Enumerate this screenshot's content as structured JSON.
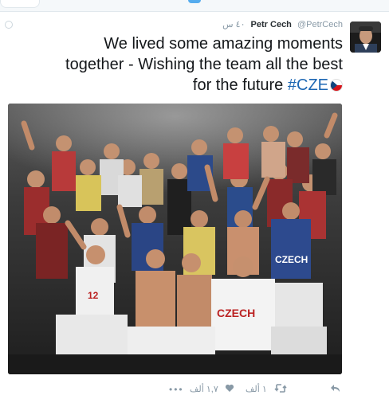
{
  "tweet": {
    "time": "٤٠ س",
    "handle": "@PetrCech",
    "name": "Petr Cech",
    "text_line1": "We lived some amazing moments",
    "text_line2": "together - Wishing the team all the best",
    "text_line3": "for the future",
    "hashtag": "#CZE",
    "photo_shirt_text1": "CZECH",
    "photo_shirt_text2": "CZECH",
    "photo_shirt_number": "12"
  },
  "actions": {
    "more": "•••",
    "likes": "١,٧ ألف",
    "retweets": "١ ألف"
  },
  "colors": {
    "hashtag": "#1b66b3",
    "meta": "#8899a6",
    "name": "#292f33"
  }
}
